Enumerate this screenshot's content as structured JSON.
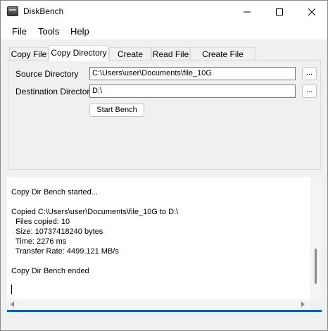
{
  "window": {
    "title": "DiskBench"
  },
  "menu": {
    "items": [
      "File",
      "Tools",
      "Help"
    ]
  },
  "tabs": [
    {
      "label": "Copy File",
      "active": false
    },
    {
      "label": "Copy Directory",
      "active": true
    },
    {
      "label": "Create File",
      "active": false
    },
    {
      "label": "Read File",
      "active": false
    },
    {
      "label": "Create File Batch",
      "active": false
    }
  ],
  "form": {
    "source_label": "Source Directory",
    "source_value": "C:\\Users\\user\\Documents\\file_10G",
    "destination_label": "Destination Directory",
    "destination_value": "D:\\",
    "browse_label": "...",
    "start_label": "Start Bench"
  },
  "log": {
    "lines": [
      "Copy Dir Bench started...",
      "",
      "Copied C:\\Users\\user\\Documents\\file_10G to D:\\",
      "  Files copied: 10",
      "  Size: 10737418240 bytes",
      "  Time: 2276 ms",
      "  Transfer Rate: 4499.121 MB/s",
      "",
      "Copy Dir Bench ended"
    ]
  },
  "colors": {
    "accent": "#005fb8"
  }
}
